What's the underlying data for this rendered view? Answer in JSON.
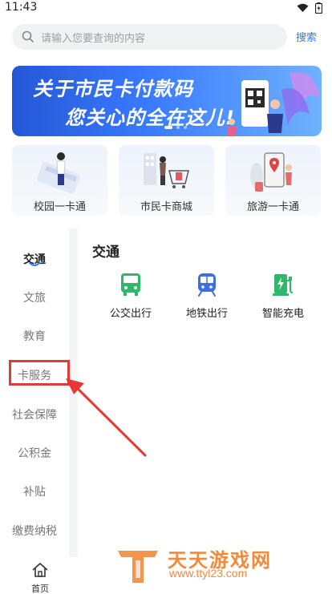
{
  "status_bar": {
    "time": "11:43"
  },
  "search": {
    "placeholder": "请输入您要查询的内容",
    "button_label": "搜索"
  },
  "banner": {
    "line1": "关于市民卡付款码",
    "line2": "您关心的全在这儿!"
  },
  "quick_links": [
    {
      "label": "校园一卡通",
      "icon": "campus-card-icon"
    },
    {
      "label": "市民卡商城",
      "icon": "mall-icon"
    },
    {
      "label": "旅游一卡通",
      "icon": "travel-card-icon"
    }
  ],
  "sidebar": {
    "items": [
      {
        "label": "交通",
        "active": true
      },
      {
        "label": "文旅"
      },
      {
        "label": "教育"
      },
      {
        "label": "卡服务"
      },
      {
        "label": "社会保障"
      },
      {
        "label": "公积金"
      },
      {
        "label": "补贴"
      },
      {
        "label": "缴费纳税"
      }
    ]
  },
  "content": {
    "title": "交通",
    "services": [
      {
        "label": "公交出行",
        "icon": "bus-icon"
      },
      {
        "label": "地铁出行",
        "icon": "subway-icon"
      },
      {
        "label": "智能充电",
        "icon": "charging-icon"
      }
    ]
  },
  "bottom_nav": {
    "home_label": "首页",
    "icon": "home-icon"
  },
  "watermark": {
    "title": "天天游戏网",
    "url": "www.ttyl23.com"
  },
  "colors": {
    "accent_blue": "#2f7bff",
    "service_green": "#2fb86b",
    "annotation_red": "#e53935",
    "watermark_orange": "#f08a3c"
  }
}
